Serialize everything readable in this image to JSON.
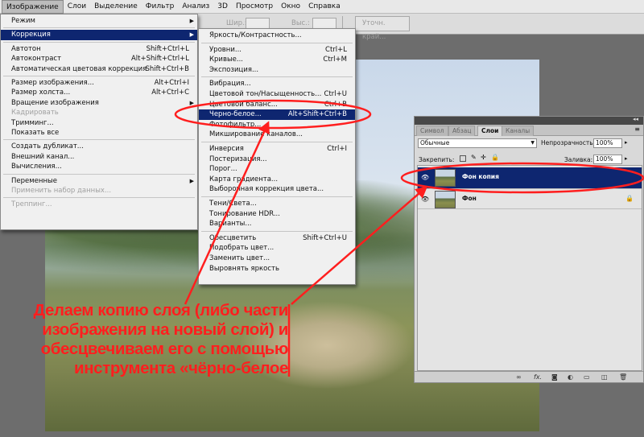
{
  "menubar": [
    "Изображение",
    "Слои",
    "Выделение",
    "Фильтр",
    "Анализ",
    "3D",
    "Просмотр",
    "Окно",
    "Справка"
  ],
  "optionsbar": {
    "width_label": "Шир.:",
    "height_label": "Выс.:",
    "refine_button": "Уточн. край..."
  },
  "image_menu": [
    {
      "label": "Режим",
      "shortcut": "",
      "submenu": true,
      "disabled": false,
      "highlight": false
    },
    {
      "sep": true
    },
    {
      "label": "Коррекция",
      "shortcut": "",
      "submenu": true,
      "disabled": false,
      "highlight": true
    },
    {
      "sep": true
    },
    {
      "label": "Автотон",
      "shortcut": "Shift+Ctrl+L",
      "submenu": false,
      "disabled": false,
      "highlight": false
    },
    {
      "label": "Автоконтраст",
      "shortcut": "Alt+Shift+Ctrl+L",
      "submenu": false,
      "disabled": false,
      "highlight": false
    },
    {
      "label": "Автоматическая цветовая коррекция",
      "shortcut": "Shift+Ctrl+B",
      "submenu": false,
      "disabled": false,
      "highlight": false
    },
    {
      "sep": true
    },
    {
      "label": "Размер изображения...",
      "shortcut": "Alt+Ctrl+I",
      "submenu": false,
      "disabled": false,
      "highlight": false
    },
    {
      "label": "Размер холста...",
      "shortcut": "Alt+Ctrl+C",
      "submenu": false,
      "disabled": false,
      "highlight": false
    },
    {
      "label": "Вращение изображения",
      "shortcut": "",
      "submenu": true,
      "disabled": false,
      "highlight": false
    },
    {
      "label": "Кадрировать",
      "shortcut": "",
      "submenu": false,
      "disabled": true,
      "highlight": false
    },
    {
      "label": "Тримминг...",
      "shortcut": "",
      "submenu": false,
      "disabled": false,
      "highlight": false
    },
    {
      "label": "Показать все",
      "shortcut": "",
      "submenu": false,
      "disabled": false,
      "highlight": false
    },
    {
      "sep": true
    },
    {
      "label": "Создать дубликат...",
      "shortcut": "",
      "submenu": false,
      "disabled": false,
      "highlight": false
    },
    {
      "label": "Внешний канал...",
      "shortcut": "",
      "submenu": false,
      "disabled": false,
      "highlight": false
    },
    {
      "label": "Вычисления...",
      "shortcut": "",
      "submenu": false,
      "disabled": false,
      "highlight": false
    },
    {
      "sep": true
    },
    {
      "label": "Переменные",
      "shortcut": "",
      "submenu": true,
      "disabled": false,
      "highlight": false
    },
    {
      "label": "Применить набор данных...",
      "shortcut": "",
      "submenu": false,
      "disabled": true,
      "highlight": false
    },
    {
      "sep": true
    },
    {
      "label": "Треппинг...",
      "shortcut": "",
      "submenu": false,
      "disabled": true,
      "highlight": false
    }
  ],
  "adjust_menu": [
    {
      "label": "Яркость/Контрастность...",
      "shortcut": "",
      "highlight": false
    },
    {
      "sep": true
    },
    {
      "label": "Уровни...",
      "shortcut": "Ctrl+L",
      "highlight": false
    },
    {
      "label": "Кривые...",
      "shortcut": "Ctrl+M",
      "highlight": false
    },
    {
      "label": "Экспозиция...",
      "shortcut": "",
      "highlight": false
    },
    {
      "sep": true
    },
    {
      "label": "Вибрация...",
      "shortcut": "",
      "highlight": false
    },
    {
      "label": "Цветовой тон/Насыщенность...",
      "shortcut": "Ctrl+U",
      "highlight": false
    },
    {
      "label": "Цветовой баланс...",
      "shortcut": "Ctrl+B",
      "highlight": false
    },
    {
      "label": "Черно-белое...",
      "shortcut": "Alt+Shift+Ctrl+B",
      "highlight": true
    },
    {
      "label": "Фотофильтр...",
      "shortcut": "",
      "highlight": false
    },
    {
      "label": "Микширование каналов...",
      "shortcut": "",
      "highlight": false
    },
    {
      "sep": true
    },
    {
      "label": "Инверсия",
      "shortcut": "Ctrl+I",
      "highlight": false
    },
    {
      "label": "Постеризация...",
      "shortcut": "",
      "highlight": false
    },
    {
      "label": "Порог...",
      "shortcut": "",
      "highlight": false
    },
    {
      "label": "Карта градиента...",
      "shortcut": "",
      "highlight": false
    },
    {
      "label": "Выборочная коррекция цвета...",
      "shortcut": "",
      "highlight": false
    },
    {
      "sep": true
    },
    {
      "label": "Тени/Света...",
      "shortcut": "",
      "highlight": false
    },
    {
      "label": "Тонирование HDR...",
      "shortcut": "",
      "highlight": false
    },
    {
      "label": "Варианты...",
      "shortcut": "",
      "highlight": false
    },
    {
      "sep": true
    },
    {
      "label": "Обесцветить",
      "shortcut": "Shift+Ctrl+U",
      "highlight": false
    },
    {
      "label": "Подобрать цвет...",
      "shortcut": "",
      "highlight": false
    },
    {
      "label": "Заменить цвет...",
      "shortcut": "",
      "highlight": false
    },
    {
      "label": "Выровнять яркость",
      "shortcut": "",
      "highlight": false
    }
  ],
  "layers_panel": {
    "tabs": [
      "Символ",
      "Абзац",
      "Слои",
      "Каналы"
    ],
    "active_tab": 2,
    "blend_mode": "Обычные",
    "opacity_label": "Непрозрачность:",
    "opacity": "100%",
    "lock_label": "Закрепить:",
    "fill_label": "Заливка:",
    "fill": "100%",
    "layers": [
      {
        "name": "Фон копия",
        "selected": true,
        "locked": false
      },
      {
        "name": "Фон",
        "selected": false,
        "locked": true
      }
    ],
    "bottom_icons": [
      "link-icon",
      "fx-icon",
      "mask-icon",
      "adjustment-icon",
      "folder-icon",
      "new-layer-icon",
      "trash-icon"
    ]
  },
  "annotation": "Делаем копию слоя (либо части\nизображения на новый слой) и\nобесцвечиваем его с помощью\nинструмента «чёрно-белое",
  "colors": {
    "menu_highlight": "#0e2670",
    "annotation": "#ff1e1e"
  }
}
